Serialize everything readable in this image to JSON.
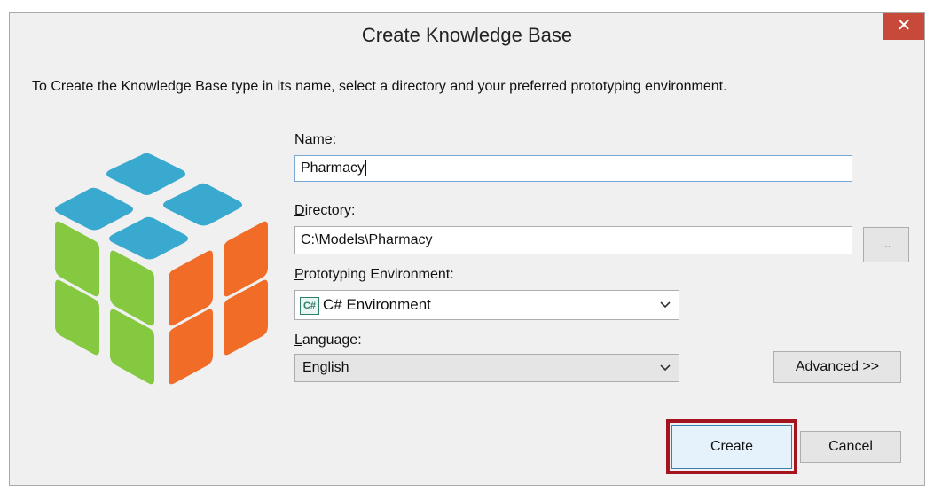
{
  "window": {
    "title": "Create Knowledge Base",
    "close_glyph": "✕"
  },
  "instructions": "To Create the Knowledge Base type in its name, select a directory and your preferred prototyping environment.",
  "logo": {
    "icon": "cube-logo-icon",
    "colors": {
      "top": "#3aa9d0",
      "left": "#84c93f",
      "right": "#f06c27"
    }
  },
  "name": {
    "label_accel": "N",
    "label_rest": "ame:",
    "value": "Pharmacy"
  },
  "directory": {
    "label_accel": "D",
    "label_rest": "irectory:",
    "value": "C:\\Models\\Pharmacy",
    "browse_label": "..."
  },
  "environment": {
    "label_accel": "P",
    "label_rest": "rototyping Environment:",
    "icon_text": "C#",
    "value": "C# Environment"
  },
  "language": {
    "label_accel": "L",
    "label_rest": "anguage:",
    "value": "English"
  },
  "buttons": {
    "advanced_accel": "A",
    "advanced_rest": "dvanced >>",
    "create": "Create",
    "cancel": "Cancel"
  },
  "colors": {
    "highlight": "#a3141e",
    "close": "#c7493a",
    "focus_border": "#7aa7d8"
  }
}
